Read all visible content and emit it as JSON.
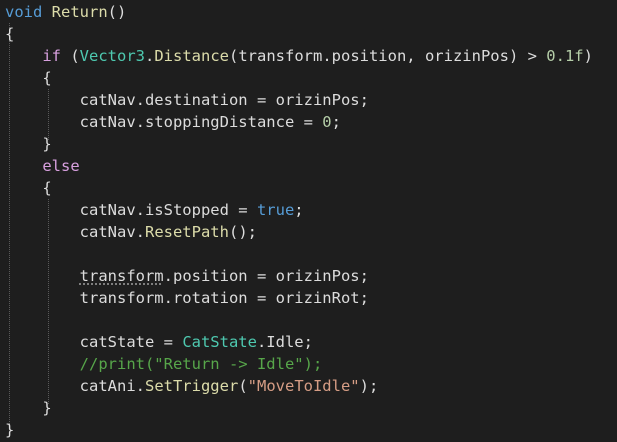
{
  "editor": {
    "colors": {
      "background": "#1e1e1e",
      "keyword": "#569cd6",
      "control": "#d8a0df",
      "type": "#4ec9b0",
      "method": "#dcdcaa",
      "string": "#d69d85",
      "number": "#b5cea8",
      "comment": "#57a64a",
      "text": "#dcdcdc"
    },
    "lines": [
      [
        {
          "t": "void",
          "c": "kw"
        },
        {
          "t": " "
        },
        {
          "t": "Return",
          "c": "method"
        },
        {
          "t": "()"
        }
      ],
      [
        {
          "t": "{"
        }
      ],
      [
        {
          "t": "    "
        },
        {
          "t": "if",
          "c": "ctl"
        },
        {
          "t": " ("
        },
        {
          "t": "Vector3",
          "c": "type"
        },
        {
          "t": "."
        },
        {
          "t": "Distance",
          "c": "method"
        },
        {
          "t": "(transform.position, orizinPos) > "
        },
        {
          "t": "0.1f",
          "c": "num"
        },
        {
          "t": ")"
        }
      ],
      [
        {
          "t": "    {"
        }
      ],
      [
        {
          "t": "        catNav.destination = orizinPos;"
        }
      ],
      [
        {
          "t": "        catNav.stoppingDistance = "
        },
        {
          "t": "0",
          "c": "num"
        },
        {
          "t": ";"
        }
      ],
      [
        {
          "t": "    }"
        }
      ],
      [
        {
          "t": "    "
        },
        {
          "t": "else",
          "c": "ctl"
        }
      ],
      [
        {
          "t": "    {"
        }
      ],
      [
        {
          "t": "        catNav.isStopped = "
        },
        {
          "t": "true",
          "c": "kw"
        },
        {
          "t": ";"
        }
      ],
      [
        {
          "t": "        catNav."
        },
        {
          "t": "ResetPath",
          "c": "method"
        },
        {
          "t": "();"
        }
      ],
      [],
      [
        {
          "t": "        "
        },
        {
          "t": "transform",
          "c": "squig"
        },
        {
          "t": ".position = orizinPos;"
        }
      ],
      [
        {
          "t": "        transform.rotation = orizinRot;"
        }
      ],
      [],
      [
        {
          "t": "        catState = "
        },
        {
          "t": "CatState",
          "c": "type"
        },
        {
          "t": ".Idle;"
        }
      ],
      [
        {
          "t": "        "
        },
        {
          "t": "//print(\"Return -> Idle\");",
          "c": "cmt"
        }
      ],
      [
        {
          "t": "        catAni."
        },
        {
          "t": "SetTrigger",
          "c": "method"
        },
        {
          "t": "("
        },
        {
          "t": "\"MoveToIdle\"",
          "c": "str"
        },
        {
          "t": ");"
        }
      ],
      [
        {
          "t": "    }"
        }
      ],
      [
        {
          "t": "}"
        }
      ]
    ]
  }
}
